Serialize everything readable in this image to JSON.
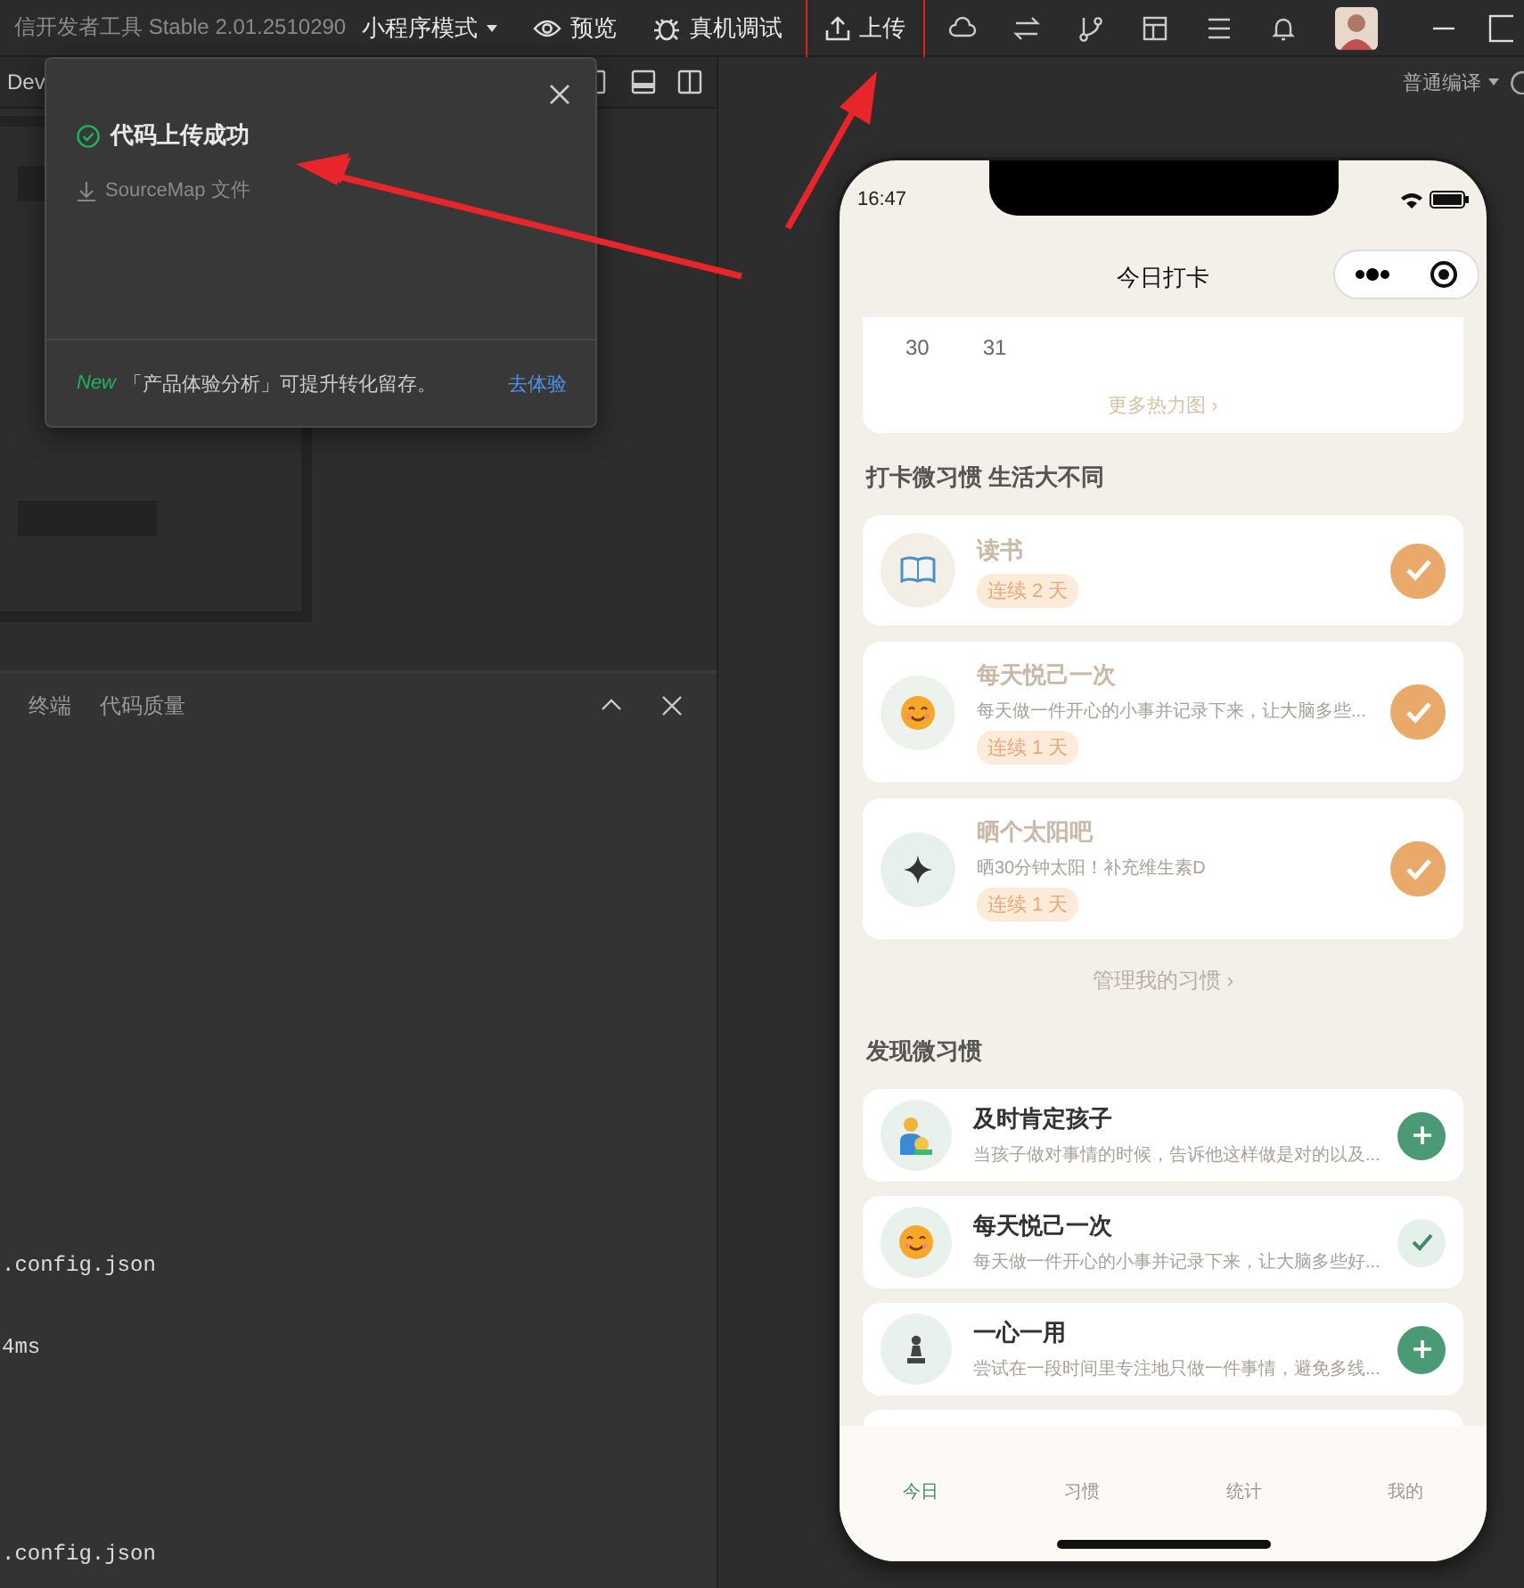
{
  "title_bar": {
    "title": "信开发者工具 Stable 2.01.2510290",
    "toolbar": [
      {
        "label": "小程序模式",
        "kind": "dropdown",
        "highlighted": false
      },
      {
        "label": "预览",
        "kind": "preview",
        "highlighted": false
      },
      {
        "label": "真机调试",
        "kind": "debug",
        "highlighted": false
      },
      {
        "label": "上传",
        "kind": "upload",
        "highlighted": true
      }
    ]
  },
  "editor_tab": {
    "label": "Dev"
  },
  "upload_popup": {
    "title": "代码上传成功",
    "file_link": "SourceMap 文件",
    "footer": {
      "badge": "New",
      "message": "「产品体验分析」可提升转化留存。",
      "action": "去体验"
    }
  },
  "bottom_panel": {
    "tabs": [
      {
        "label": "终端",
        "selected": false
      },
      {
        "label": "代码质量",
        "selected": false
      }
    ],
    "console_lines": [
      ".config.json",
      "4ms",
      ".config.json"
    ]
  },
  "compile_mode": {
    "label": "普通编译"
  },
  "phone": {
    "time": "16:47",
    "nav_title": "今日打卡",
    "heatmap": {
      "days": [
        "30",
        "31"
      ],
      "more_link": "更多热力图 ›"
    },
    "habits_heading": "打卡微习惯 生活大不同",
    "habits": [
      {
        "name": "读书",
        "streak": "连续 2 天",
        "checked": true
      },
      {
        "name": "每天悦己一次",
        "description": "每天做一件开心的小事并记录下来，让大脑多些...",
        "streak": "连续 1 天",
        "checked": true
      },
      {
        "name": "晒个太阳吧",
        "description": "晒30分钟太阳！补充维生素D",
        "streak": "连续 1 天",
        "checked": true
      }
    ],
    "manage_link": "管理我的习惯 ›",
    "discover_heading": "发现微习惯",
    "discover": [
      {
        "name": "及时肯定孩子",
        "description": "当孩子做对事情的时候，告诉他这样做是对的以及...",
        "added": false
      },
      {
        "name": "每天悦己一次",
        "description": "每天做一件开心的小事并记录下来，让大脑多些好...",
        "added": true
      },
      {
        "name": "一心一用",
        "description": "尝试在一段时间里专注地只做一件事情，避免多线...",
        "added": false
      }
    ],
    "tabs": [
      {
        "label": "今日",
        "selected": true
      },
      {
        "label": "习惯",
        "selected": false
      },
      {
        "label": "统计",
        "selected": false
      },
      {
        "label": "我的",
        "selected": false
      }
    ]
  }
}
